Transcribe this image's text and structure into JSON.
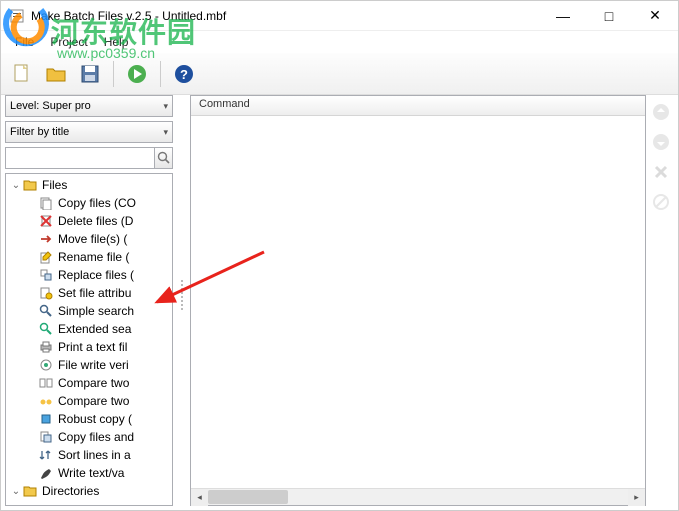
{
  "window": {
    "title": "Make Batch Files v.2.5 - Untitled.mbf",
    "controls": {
      "min": "—",
      "max": "□",
      "close": "✕"
    }
  },
  "menubar": {
    "items": [
      "File",
      "Project",
      "Help"
    ]
  },
  "toolbar": {
    "new": "new-file-icon",
    "open": "open-folder-icon",
    "save": "save-disk-icon",
    "run": "play-icon",
    "help": "help-icon"
  },
  "left": {
    "level_label": "Level: Super pro",
    "filter_label": "Filter by title",
    "search_value": "",
    "tree": {
      "root1": {
        "label": "Files",
        "expanded": true
      },
      "children": [
        "Copy files (CO",
        "Delete files (D",
        "Move file(s) (",
        "Rename file (",
        "Replace files (",
        "Set file attribu",
        "Simple search",
        "Extended sea",
        "Print a text fil",
        "File write veri",
        "Compare two",
        "Compare two",
        "Robust copy (",
        "Copy files and",
        "Sort lines in a",
        "Write text/va"
      ],
      "root2": {
        "label": "Directories",
        "expanded": true
      }
    }
  },
  "right": {
    "header": "Command"
  },
  "sidebuttons": {
    "up": "arrow-up-icon",
    "down": "arrow-down-icon",
    "delete": "x-icon",
    "block": "block-icon"
  },
  "watermark": {
    "text": "河东软件园",
    "url": "www.pc0359.cn"
  }
}
